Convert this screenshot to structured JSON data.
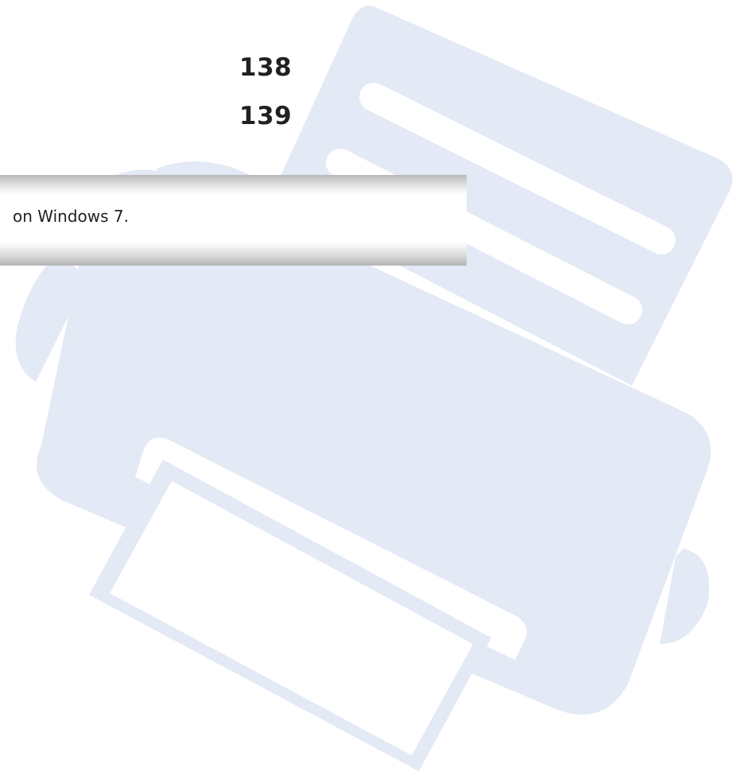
{
  "page_numbers": [
    "138",
    "139"
  ],
  "banner": {
    "text": "on Windows 7."
  },
  "colors": {
    "illustration_fill": "#e3e9f5",
    "page_background": "#ffffff",
    "text": "#231f20"
  },
  "icons": {
    "background": "printer-icon"
  }
}
